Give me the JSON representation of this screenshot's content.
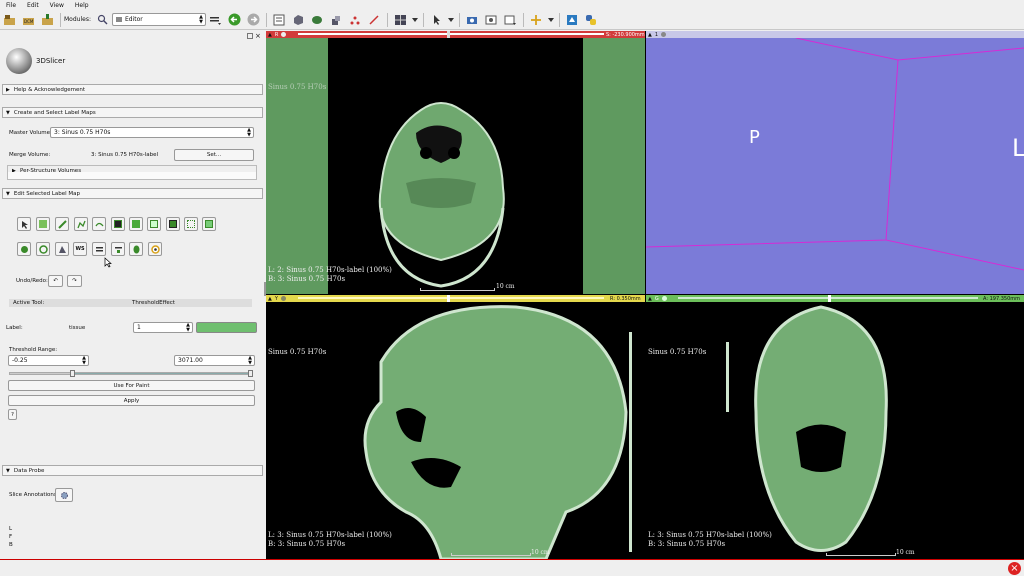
{
  "menu": [
    "File",
    "Edit",
    "View",
    "Help"
  ],
  "toolbar": {
    "modules_label": "Modules:",
    "module_value": "Editor"
  },
  "logo_text": "3DSlicer",
  "sections": {
    "help": "Help & Acknowledgement",
    "create": "Create and Select Label Maps",
    "edit": "Edit Selected Label Map",
    "probe": "Data Probe"
  },
  "create": {
    "master_label": "Master Volume:",
    "master_value": "3: Sinus  0.75  H70s",
    "merge_label": "Merge Volume:",
    "merge_value": "3: Sinus  0.75  H70s-label",
    "set_button": "Set...",
    "per_structure": "Per-Structure Volumes"
  },
  "edit": {
    "undo_redo": "Undo/Redo:",
    "active_tool_label": "Active Tool:",
    "active_tool_value": "ThresholdEffect",
    "label_label": "Label:",
    "label_name": "tissue",
    "label_value": "1",
    "label_color": "#6fbf6f",
    "threshold_label": "Threshold Range:",
    "threshold_min": "-0.25",
    "threshold_max": "3071.00",
    "use_for_paint": "Use For Paint",
    "apply": "Apply",
    "help_q": "?"
  },
  "probe": {
    "slice_annotations": "Slice Annotations:",
    "lines": [
      "L",
      "F",
      "B"
    ]
  },
  "views": {
    "red": {
      "letter": "R",
      "offset": "S: -230.900mm",
      "line1": "L: 2: Sinus  0.75  H70s-label (100%)",
      "line2": "B: 3: Sinus  0.75  H70s",
      "top": "Sinus  0.75  H70s",
      "scale": "10 cm",
      "color": "#d23b3b"
    },
    "threed": {
      "letter": "1",
      "labels": [
        "P",
        "L"
      ],
      "bg": "#7b7bd8"
    },
    "yellow": {
      "letter": "Y",
      "offset": "R: 0.350mm",
      "line1": "L: 3: Sinus  0.75  H70s-label (100%)",
      "line2": "B: 3: Sinus  0.75  H70s",
      "top": "Sinus  0.75  H70s",
      "scale": "10 cm",
      "color": "#e4d84c"
    },
    "green": {
      "letter": "G",
      "offset": "A: 197.350mm",
      "line1": "L: 3: Sinus  0.75  H70s-label (100%)",
      "line2": "B: 3: Sinus  0.75  H70s",
      "top": "Sinus  0.75  H70s",
      "scale": "10 cm",
      "color": "#6cbf5a"
    }
  }
}
